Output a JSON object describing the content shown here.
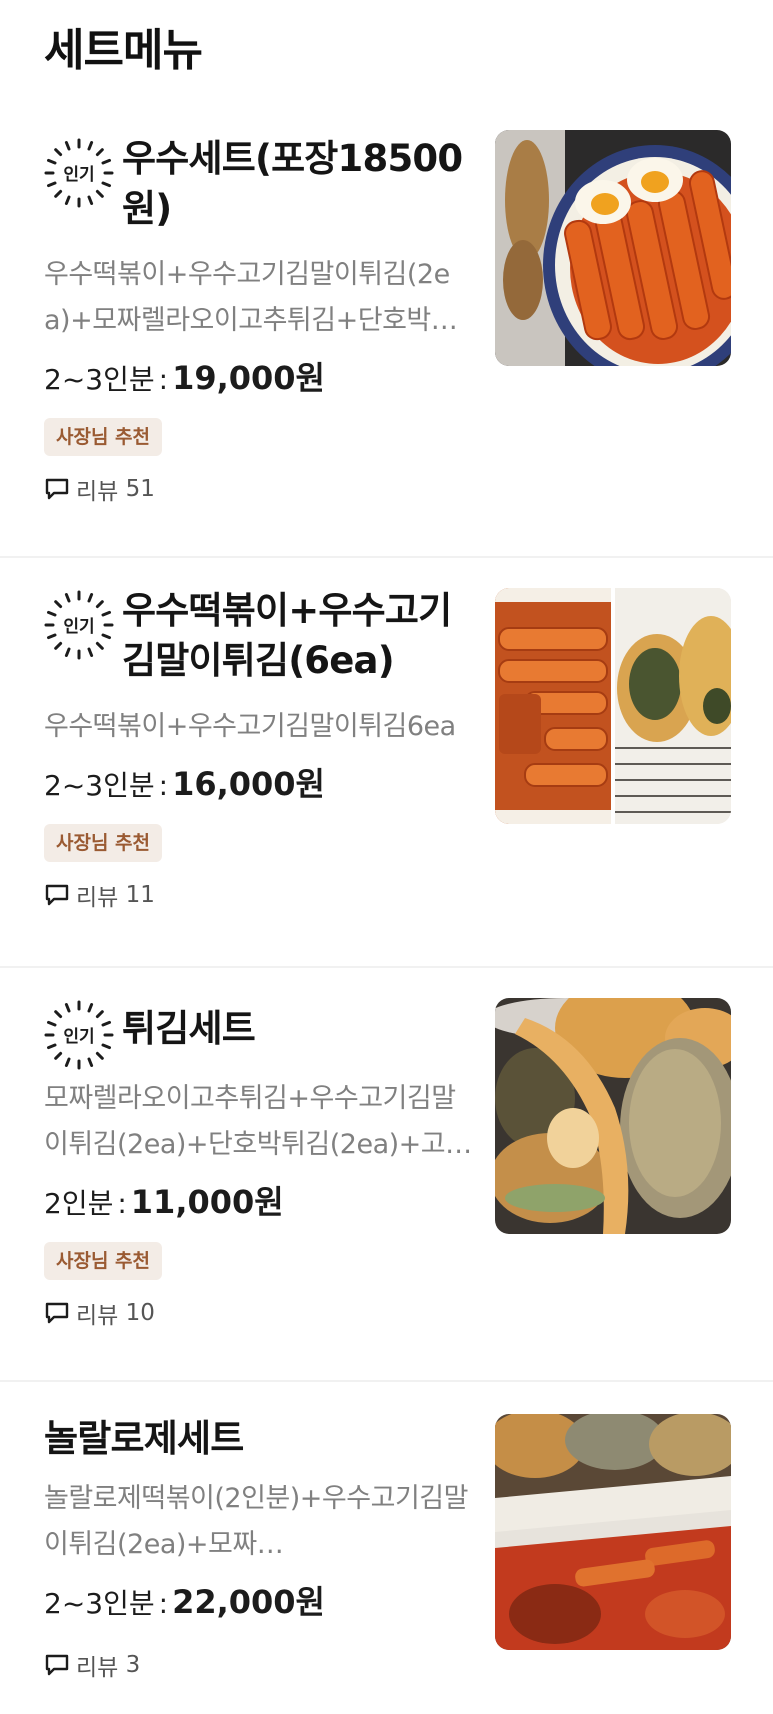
{
  "section": {
    "title": "세트메뉴"
  },
  "common": {
    "popular_badge": "인기",
    "owner_badge": "사장님 추천",
    "review_label": "리뷰"
  },
  "items": [
    {
      "name": "우수세트(포장18500원)",
      "description": "우수떡볶이+우수고기김말이튀김(2ea)+모짜렐라오이고추튀김+단호박…",
      "serving": "2~3인분",
      "separator": ":",
      "price": "19,000원",
      "reviews": "51",
      "image": "tteokbokki-eggs-photo"
    },
    {
      "name": "우수떡볶이+우수고기김말이튀김(6ea)",
      "description": "우수떡볶이+우수고기김말이튀김6ea",
      "serving": "2~3인분",
      "separator": ":",
      "price": "16,000원",
      "reviews": "11",
      "image": "tteokbokki-gimmari-photo"
    },
    {
      "name": "튀김세트",
      "description": "모짜렐라오이고추튀김+우수고기김말이튀김(2ea)+단호박튀김(2ea)+고…",
      "serving": "2인분",
      "separator": ":",
      "price": "11,000원",
      "reviews": "10",
      "image": "fried-set-photo"
    },
    {
      "name": "놀랄로제세트",
      "description": "놀랄로제떡볶이(2인분)+우수고기김말이튀김(2ea)+모짜…",
      "serving": "2~3인분",
      "separator": ":",
      "price": "22,000원",
      "reviews": "3",
      "image": "rose-set-photo"
    }
  ]
}
